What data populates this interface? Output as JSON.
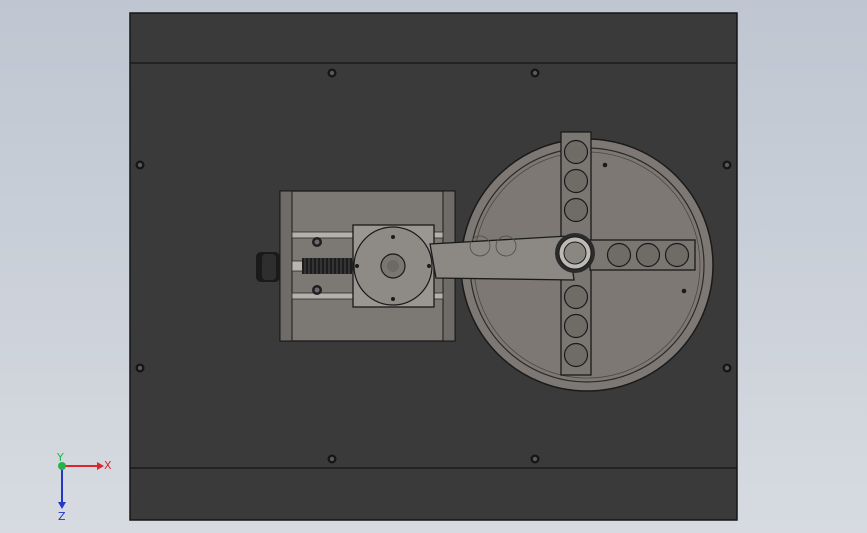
{
  "app": {
    "viewport_background": "#c9cfd8"
  },
  "model": {
    "colors": {
      "base_plate": "#3a3a3a",
      "plate_edge": "#1b1b1b",
      "slide_housing": "#7c7873",
      "motor_block": "#9a9692",
      "disc": "#7d7874",
      "spoke": "#7a7672",
      "crank_arm": "#8c8884",
      "shaft": "#2b2b2b"
    },
    "disc_holes_per_spoke": 3
  },
  "triad": {
    "x_label": "X",
    "y_label": "Y",
    "z_label": "Z",
    "x_color": "#e0242b",
    "y_color": "#25b34a",
    "z_color": "#2236c8"
  }
}
